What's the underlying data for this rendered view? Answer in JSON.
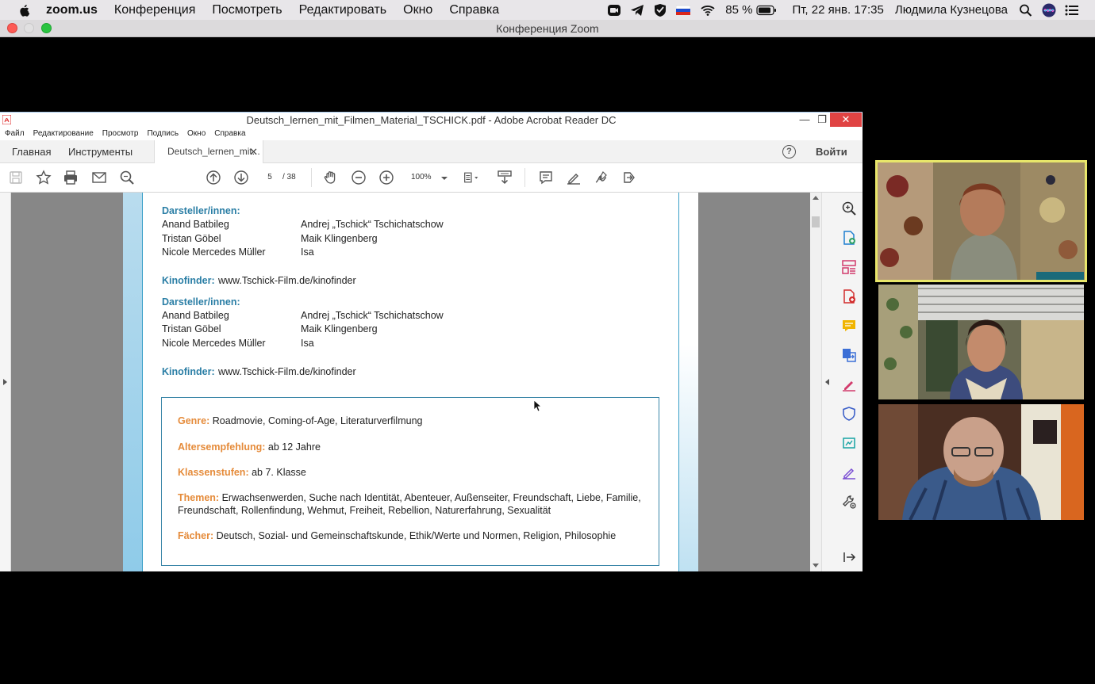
{
  "mac_menubar": {
    "app_name": "zoom.us",
    "menus": [
      "Конференция",
      "Посмотреть",
      "Редактировать",
      "Окно",
      "Справка"
    ],
    "battery": "85 %",
    "datetime": "Пт, 22 янв.  17:35",
    "user": "Людмила Кузнецова"
  },
  "zoom_window": {
    "title": "Конференция Zoom"
  },
  "acrobat": {
    "title": "Deutsch_lernen_mit_Filmen_Material_TSCHICK.pdf - Adobe Acrobat Reader DC",
    "menu": [
      "Файл",
      "Редактирование",
      "Просмотр",
      "Подпись",
      "Окно",
      "Справка"
    ],
    "tabs": {
      "home": "Главная",
      "tools": "Инструменты",
      "doc": "Deutsch_lernen_mit...",
      "login": "Войти"
    },
    "toolbar": {
      "page_current": "5",
      "page_total": "/ 38",
      "zoom": "100%"
    }
  },
  "pdf_page": {
    "block1": {
      "heading": "Darsteller/innen:",
      "cast": [
        {
          "actor": "Anand Batbileg",
          "role": "Andrej „Tschick“ Tschichatschow"
        },
        {
          "actor": "Tristan Göbel",
          "role": "Maik Klingenberg"
        },
        {
          "actor": "Nicole Mercedes Müller",
          "role": "Isa"
        }
      ],
      "kinofinder_label": "Kinofinder:",
      "kinofinder_url": "www.Tschick-Film.de/kinofinder"
    },
    "block2": {
      "heading": "Darsteller/innen:",
      "cast": [
        {
          "actor": "Anand Batbileg",
          "role": "Andrej „Tschick“ Tschichatschow"
        },
        {
          "actor": "Tristan Göbel",
          "role": "Maik Klingenberg"
        },
        {
          "actor": "Nicole Mercedes Müller",
          "role": "Isa"
        }
      ],
      "kinofinder_label": "Kinofinder:",
      "kinofinder_url": "www.Tschick-Film.de/kinofinder"
    },
    "info": {
      "genre_label": "Genre:",
      "genre": "Roadmovie, Coming-of-Age, Literaturverfilmung",
      "age_label": "Altersempfehlung:",
      "age": "ab 12 Jahre",
      "grade_label": "Klassenstufen:",
      "grade": "ab 7. Klasse",
      "themes_label": "Themen:",
      "themes_line1": "Erwachsenwerden, Suche nach Identität, Abenteuer, Außenseiter, Freundschaft, Liebe, Familie,",
      "themes_line2": "Freundschaft, Rollenfindung, Wehmut, Freiheit, Rebellion, Naturerfahrung, Sexualität",
      "subjects_label": "Fächer:",
      "subjects": "Deutsch, Sozial- und Gemeinschaftskunde, Ethik/Werte und Normen, Religion, Philosophie"
    }
  },
  "colors": {
    "active_speaker": "#e8e66a",
    "heading_blue": "#2a7ea5",
    "label_orange": "#e58b3a",
    "acrobat_close": "#e04343"
  }
}
